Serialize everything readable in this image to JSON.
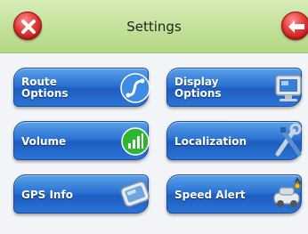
{
  "header": {
    "title": "Settings",
    "close_icon": "close-x-icon",
    "back_icon": "back-arrow-icon"
  },
  "menu": {
    "route_options": {
      "label": "Route\nOptions",
      "icon": "route-curve-icon"
    },
    "display_options": {
      "label": "Display\nOptions",
      "icon": "monitor-icon"
    },
    "volume": {
      "label": "Volume",
      "icon": "volume-bars-icon"
    },
    "localization": {
      "label": "Localization",
      "icon": "tools-icon"
    },
    "gps_info": {
      "label": "GPS Info",
      "icon": "gps-device-icon"
    },
    "speed_alert": {
      "label": "Speed Alert",
      "icon": "speed-camera-car-icon"
    }
  },
  "colors": {
    "header_green": "#c4e29c",
    "tile_blue": "#2b73d3",
    "button_red": "#e53a3a"
  }
}
